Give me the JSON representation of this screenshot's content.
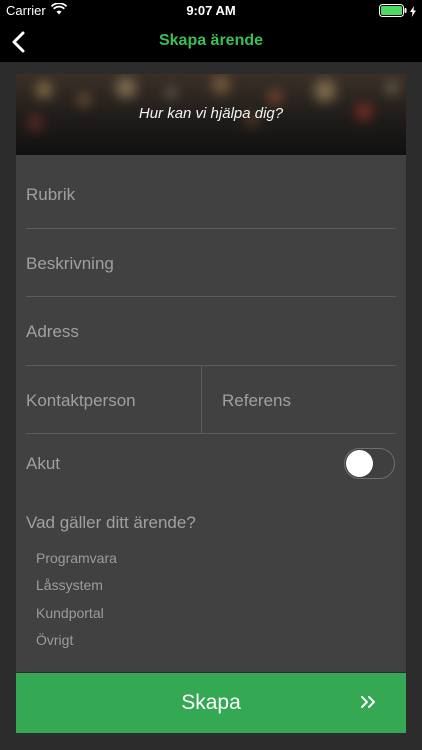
{
  "status_bar": {
    "carrier": "Carrier",
    "time": "9:07 AM"
  },
  "nav": {
    "title": "Skapa ärende"
  },
  "hero": {
    "tagline": "Hur kan vi hjälpa dig?"
  },
  "form": {
    "rubrik_placeholder": "Rubrik",
    "beskrivning_placeholder": "Beskrivning",
    "adress_placeholder": "Adress",
    "kontaktperson_placeholder": "Kontaktperson",
    "referens_placeholder": "Referens",
    "akut_label": "Akut",
    "akut_on": false,
    "category_question": "Vad gäller ditt ärende?",
    "category_options": [
      "Programvara",
      "Låssystem",
      "Kundportal",
      "Övrigt"
    ]
  },
  "submit": {
    "label": "Skapa"
  },
  "icons": {
    "back": "chevron-left-icon",
    "wifi": "wifi-icon",
    "battery": "battery-icon",
    "submit": "double-chevron-right-icon"
  },
  "colors": {
    "accent": "#3bbf55",
    "button": "#34a853",
    "card": "#414141",
    "background": "#2c2c2c"
  }
}
